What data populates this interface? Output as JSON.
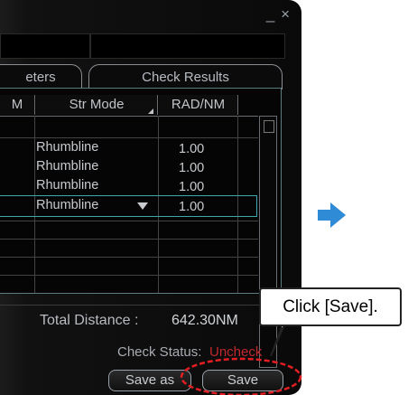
{
  "window": {
    "close_glyph": "_ ×"
  },
  "tabs": [
    {
      "label": "eters"
    },
    {
      "label": "Check Results"
    }
  ],
  "table": {
    "headers": [
      "M",
      "Str Mode",
      "RAD/NM"
    ],
    "rows": [
      {
        "mode": "Rhumbline",
        "rad": "1.00"
      },
      {
        "mode": "Rhumbline",
        "rad": "1.00"
      },
      {
        "mode": "Rhumbline",
        "rad": "1.00"
      },
      {
        "mode": "Rhumbline",
        "rad": "1.00"
      }
    ]
  },
  "total_distance": {
    "label": "Total Distance :",
    "value": "642.30NM"
  },
  "check_status": {
    "label": "Check Status:",
    "value": "Uncheck",
    "value_color": "#c0282d"
  },
  "buttons": {
    "save_as": "Save as",
    "save": "Save"
  },
  "callout": {
    "text": "Click [Save]."
  },
  "colors": {
    "highlight": "#e31f24",
    "arrow": "#2f8bd6",
    "row_selected": "#3fa7a9"
  }
}
